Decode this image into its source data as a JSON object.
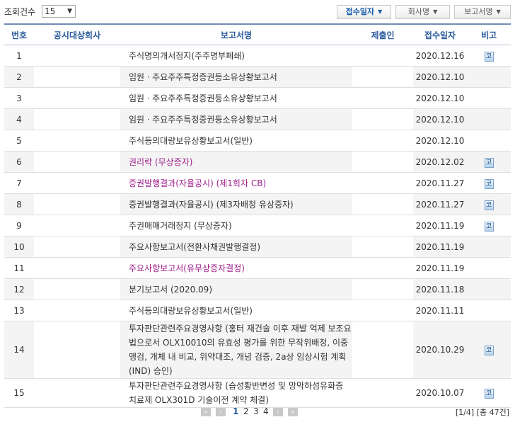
{
  "toolbar": {
    "count_label": "조회건수",
    "count_value": "15",
    "sort_buttons": [
      {
        "label": "접수일자",
        "active": true
      },
      {
        "label": "회사명",
        "active": false
      },
      {
        "label": "보고서명",
        "active": false
      }
    ]
  },
  "table": {
    "headers": {
      "no": "번호",
      "company": "공시대상회사",
      "report": "보고서명",
      "submitter": "제출인",
      "date": "접수일자",
      "note": "비고"
    },
    "note_icon_text": "코",
    "rows": [
      {
        "no": "1",
        "report": "주식명의개서정지(주주명부폐쇄)",
        "date": "2020.12.16",
        "note": true,
        "purple": false
      },
      {
        "no": "2",
        "report": "임원ㆍ주요주주특정증권등소유상황보고서",
        "date": "2020.12.10",
        "note": false,
        "purple": false
      },
      {
        "no": "3",
        "report": "임원ㆍ주요주주특정증권등소유상황보고서",
        "date": "2020.12.10",
        "note": false,
        "purple": false
      },
      {
        "no": "4",
        "report": "임원ㆍ주요주주특정증권등소유상황보고서",
        "date": "2020.12.10",
        "note": false,
        "purple": false
      },
      {
        "no": "5",
        "report": "주식등의대량보유상황보고서(일반)",
        "date": "2020.12.10",
        "note": false,
        "purple": false
      },
      {
        "no": "6",
        "report": "권리락 (무상증자)",
        "date": "2020.12.02",
        "note": true,
        "purple": true
      },
      {
        "no": "7",
        "report": "증권발행결과(자율공시) (제1회차 CB)",
        "date": "2020.11.27",
        "note": true,
        "purple": true
      },
      {
        "no": "8",
        "report": "증권발행결과(자율공시) (제3자배정 유상증자)",
        "date": "2020.11.27",
        "note": true,
        "purple": false
      },
      {
        "no": "9",
        "report": "주권매매거래정지 (무상증자)",
        "date": "2020.11.19",
        "note": true,
        "purple": false
      },
      {
        "no": "10",
        "report": "주요사항보고서(전환사채권발행결정)",
        "date": "2020.11.19",
        "note": false,
        "purple": false
      },
      {
        "no": "11",
        "report": "주요사항보고서(유무상증자결정)",
        "date": "2020.11.19",
        "note": false,
        "purple": true
      },
      {
        "no": "12",
        "report": "분기보고서 (2020.09)",
        "date": "2020.11.18",
        "note": false,
        "purple": false
      },
      {
        "no": "13",
        "report": "주식등의대량보유상황보고서(일반)",
        "date": "2020.11.11",
        "note": false,
        "purple": false
      },
      {
        "no": "14",
        "report": "투자판단관련주요경영사항 (홍터 재건술 이후 재발 억제 보조요법으로서 OLX10010의 유효성 평가를 위한 무작위배정, 이중 맹검, 개체 내 비교, 위약대조, 개념 검증, 2a상 임상시험 계획(IND) 승인)",
        "date": "2020.10.29",
        "note": true,
        "purple": false
      },
      {
        "no": "15",
        "report": "투자판단관련주요경영사항 (습성황반변성 및 망막하섬유화증 치료제 OLX301D 기술이전 계약 체결)",
        "date": "2020.10.07",
        "note": true,
        "purple": false
      }
    ]
  },
  "pager": {
    "first": "«",
    "prev": "‹",
    "pages": [
      "1",
      "2",
      "3",
      "4"
    ],
    "current": "1",
    "next": "›",
    "last": "»",
    "summary": "[1/4] [총 47건]"
  },
  "colors": {
    "header_text": "#2a5a9c",
    "purple_link": "#a0208c",
    "stripe": "#f4f4f4"
  }
}
